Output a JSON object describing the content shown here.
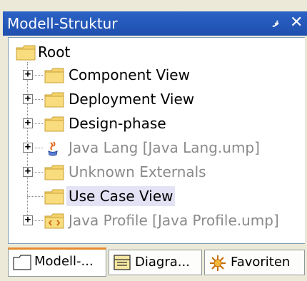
{
  "window": {
    "title": "Modell-Struktur",
    "pin_icon": "pin-icon",
    "close_icon": "close-icon"
  },
  "tree": {
    "root": {
      "label": "Root",
      "icon": "folder-icon"
    },
    "items": [
      {
        "label": "Component View",
        "icon": "folder-icon",
        "expandable": true,
        "greyed": false,
        "selected": false
      },
      {
        "label": "Deployment View",
        "icon": "folder-icon",
        "expandable": true,
        "greyed": false,
        "selected": false
      },
      {
        "label": "Design-phase",
        "icon": "folder-icon",
        "expandable": true,
        "greyed": false,
        "selected": false
      },
      {
        "label": "Java Lang [Java Lang.ump]",
        "icon": "java-package-icon",
        "expandable": true,
        "greyed": true,
        "selected": false
      },
      {
        "label": "Unknown Externals",
        "icon": "folder-icon",
        "expandable": true,
        "greyed": true,
        "selected": false
      },
      {
        "label": "Use Case View",
        "icon": "folder-icon",
        "expandable": false,
        "greyed": false,
        "selected": true
      },
      {
        "label": "Java Profile [Java Profile.ump]",
        "icon": "profile-package-icon",
        "expandable": true,
        "greyed": true,
        "selected": false
      }
    ]
  },
  "tabs": [
    {
      "label": "Modell-...",
      "icon": "model-tree-icon",
      "active": true
    },
    {
      "label": "Diagra...",
      "icon": "diagram-tree-icon",
      "active": false
    },
    {
      "label": "Favoriten",
      "icon": "favorites-icon",
      "active": false
    }
  ],
  "colors": {
    "titlebar": "#2b62c5",
    "folder": "#f5d26b",
    "greyed_text": "#8a8a8a",
    "active_tab_accent": "#e68b2c"
  }
}
